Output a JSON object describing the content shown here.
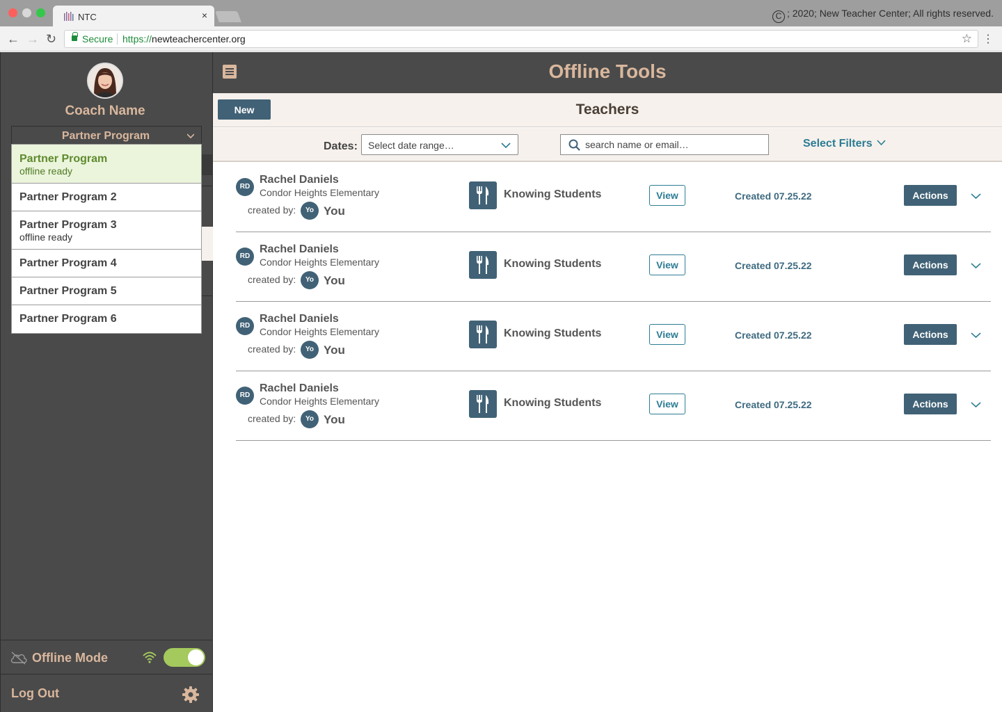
{
  "browser": {
    "tab_title": "NTC",
    "tab_close": "×",
    "copyright_symbol": "C",
    "copyright_text": "; 2020; New Teacher Center; All rights reserved.",
    "secure_label": "Secure",
    "url_scheme": "https://",
    "url_host": "newteachercenter.org"
  },
  "sidebar": {
    "coach_name": "Coach Name",
    "program_select_value": "Partner Program",
    "programs": [
      {
        "name": "Partner Program",
        "status": "offline ready",
        "selected": true
      },
      {
        "name": "Partner Program 2",
        "status": ""
      },
      {
        "name": "Partner Program 3",
        "status": "offline ready"
      },
      {
        "name": "Partner Program 4",
        "status": ""
      },
      {
        "name": "Partner Program 5",
        "status": ""
      },
      {
        "name": "Partner Program 6",
        "status": ""
      }
    ],
    "offline_mode_label": "Offline Mode",
    "offline_mode_on": true,
    "logout_label": "Log Out"
  },
  "header": {
    "title": "Offline Tools"
  },
  "subheader": {
    "new_button": "New",
    "section_title": "Teachers"
  },
  "filters": {
    "dates_label": "Dates:",
    "date_range_value": "Select date range…",
    "search_placeholder": "search name or email…",
    "select_filters_label": "Select Filters"
  },
  "rows": [
    {
      "initials": "RD",
      "teacher_name": "Rachel Daniels",
      "school": "Condor Heights Elementary",
      "created_by_label": "created by:",
      "creator_initials": "Yo",
      "creator_name": "You",
      "tool_name": "Knowing Students",
      "view_label": "View",
      "created_date": "Created 07.25.22",
      "actions_label": "Actions"
    },
    {
      "initials": "RD",
      "teacher_name": "Rachel Daniels",
      "school": "Condor Heights Elementary",
      "created_by_label": "created by:",
      "creator_initials": "Yo",
      "creator_name": "You",
      "tool_name": "Knowing Students",
      "view_label": "View",
      "created_date": "Created 07.25.22",
      "actions_label": "Actions"
    },
    {
      "initials": "RD",
      "teacher_name": "Rachel Daniels",
      "school": "Condor Heights Elementary",
      "created_by_label": "created by:",
      "creator_initials": "Yo",
      "creator_name": "You",
      "tool_name": "Knowing Students",
      "view_label": "View",
      "created_date": "Created 07.25.22",
      "actions_label": "Actions"
    },
    {
      "initials": "RD",
      "teacher_name": "Rachel Daniels",
      "school": "Condor Heights Elementary",
      "created_by_label": "created by:",
      "creator_initials": "Yo",
      "creator_name": "You",
      "tool_name": "Knowing Students",
      "view_label": "View",
      "created_date": "Created 07.25.22",
      "actions_label": "Actions"
    }
  ],
  "colors": {
    "sidebar_bg": "#4a4a4a",
    "accent_tan": "#d9b79d",
    "primary_button": "#416276",
    "link_teal": "#2c7c94",
    "selected_program_bg": "#ebf5dc",
    "toggle_on": "#a4c95d"
  },
  "icons": {
    "menu": "hamburger-menu-icon",
    "search": "search-icon",
    "tool": "fork-knife-tools-icon",
    "cloud": "cloud-offline-icon",
    "wifi": "wifi-icon",
    "gear": "gear-icon",
    "chevron": "chevron-down-icon"
  }
}
